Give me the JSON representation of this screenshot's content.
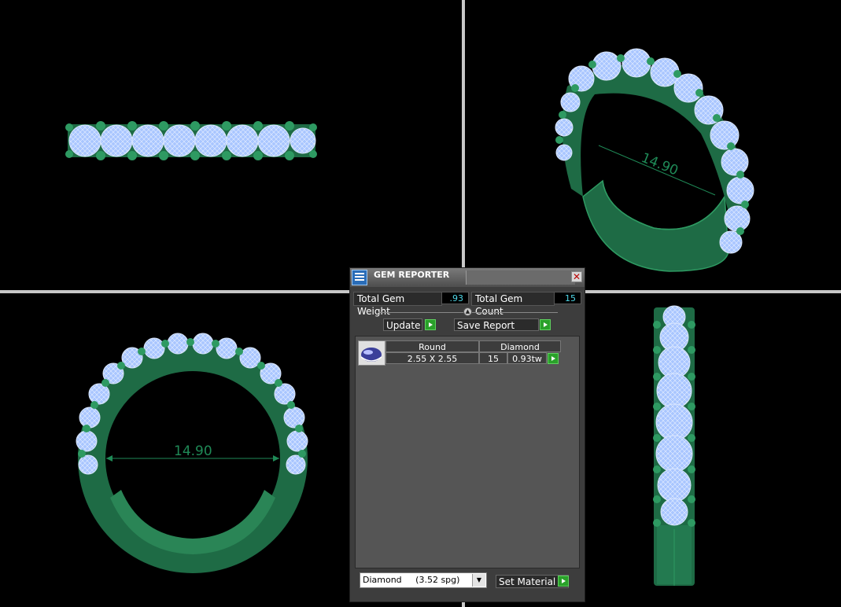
{
  "viewports": {
    "top_left": {
      "name": "top-view",
      "dimension": ""
    },
    "top_right": {
      "name": "perspective-view",
      "dimension": "14.90"
    },
    "bottom_left": {
      "name": "front-view",
      "dimension": "14.90"
    },
    "bottom_right": {
      "name": "side-view",
      "dimension": ""
    }
  },
  "panel": {
    "title": "GEM REPORTER",
    "close_glyph": "✕",
    "total_weight_label": "Total Gem Weight",
    "total_weight_value": ".93",
    "total_count_label": "Total Gem Count",
    "total_count_value": "15",
    "update_label": "Update",
    "save_report_label": "Save Report",
    "table": {
      "headers": [
        "Round",
        "Diamond"
      ],
      "rows": [
        {
          "size": "2.55 X 2.55",
          "count": "15",
          "weight": "0.93tw"
        }
      ]
    },
    "material_select": {
      "name": "Diamond",
      "density": "(3.52 spg)"
    },
    "set_material_label": "Set Material"
  },
  "colors": {
    "metal": "#1e6b45",
    "metal_light": "#2e9a62",
    "gem": "#a9c6ff",
    "dimension": "#1f8a57",
    "value_text": "#4fd8e8",
    "button_green": "#2aa12a"
  },
  "icons": {
    "title": "gem-reporter-icon",
    "close": "close-icon",
    "slider": "slider-knob-icon",
    "play": "play-arrow-icon",
    "dropdown": "chevron-down-icon",
    "logo": "app-logo-icon"
  }
}
